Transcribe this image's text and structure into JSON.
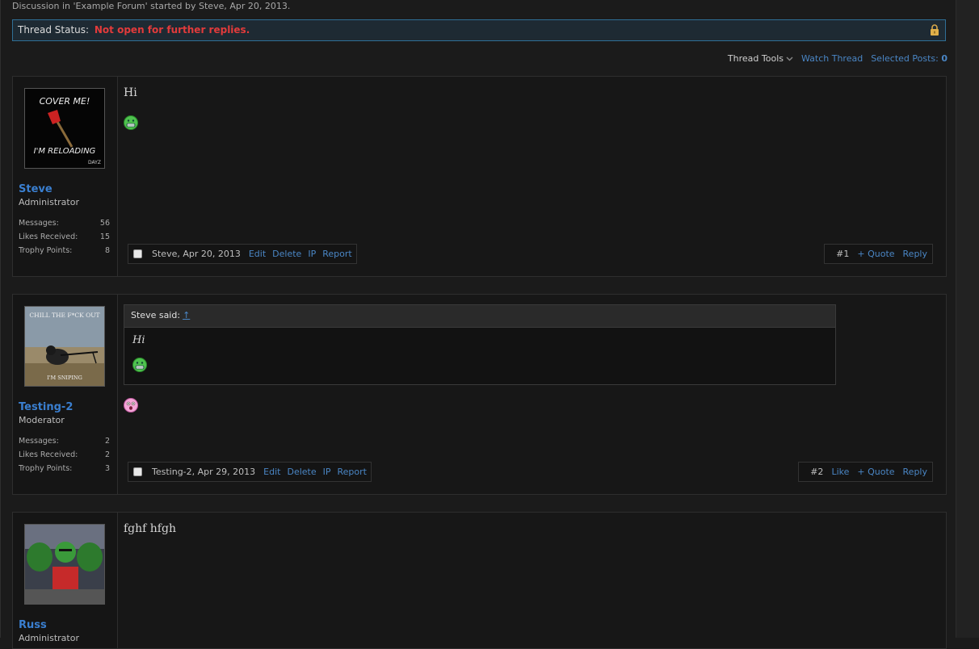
{
  "thread": {
    "description": "Discussion in 'Example Forum' started by Steve, Apr 20, 2013.",
    "status_label": "Thread Status:",
    "status_value": "Not open for further replies."
  },
  "toolbar": {
    "thread_tools": "Thread Tools",
    "watch_thread": "Watch Thread",
    "selected_posts_label": "Selected Posts:",
    "selected_posts_count": "0"
  },
  "stat_labels": {
    "messages": "Messages:",
    "likes": "Likes Received:",
    "trophy": "Trophy Points:"
  },
  "posts": [
    {
      "username": "Steve",
      "role": "Administrator",
      "messages": "56",
      "likes": "15",
      "trophy": "8",
      "avatar_text_top": "COVER ME!",
      "avatar_text_bottom": "I'M RELOADING",
      "avatar_tag": "DAYZ",
      "text": "Hi",
      "meta": "Steve, Apr 20, 2013",
      "actions": [
        "Edit",
        "Delete",
        "IP",
        "Report"
      ],
      "number": "#1",
      "right_actions": [
        "+ Quote",
        "Reply"
      ]
    },
    {
      "username": "Testing-2",
      "role": "Moderator",
      "messages": "2",
      "likes": "2",
      "trophy": "3",
      "avatar_text_top": "CHILL THE F*CK OUT",
      "avatar_text_bottom": "I'M SNIPING",
      "quote_author": "Steve said:",
      "quote_arrow": "↑",
      "quote_text": "Hi",
      "meta": "Testing-2, Apr 29, 2013",
      "actions": [
        "Edit",
        "Delete",
        "IP",
        "Report"
      ],
      "number": "#2",
      "right_actions": [
        "Like",
        "+ Quote",
        "Reply"
      ]
    },
    {
      "username": "Russ",
      "role": "Administrator",
      "text": "fghf hfgh"
    }
  ],
  "colors": {
    "accent": "#3a7fd0",
    "link": "#4a86c5",
    "status_red": "#e23b3b"
  }
}
